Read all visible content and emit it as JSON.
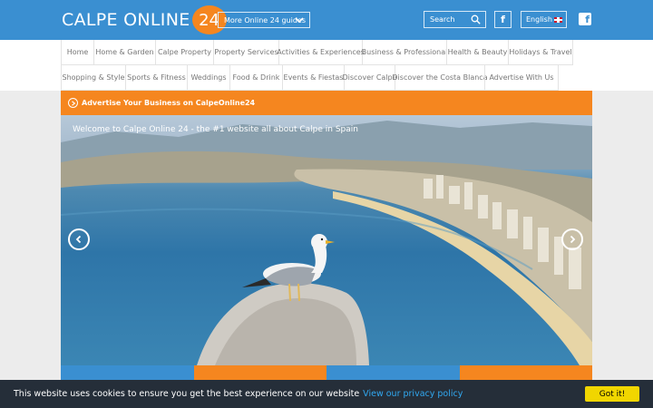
{
  "header": {
    "logo_text": "CALPE ONLINE",
    "logo_number": "24",
    "guides_label": "More Online 24 guides",
    "search_placeholder": "Search",
    "facebook_letter": "f",
    "language_label": "English"
  },
  "nav": {
    "row1": [
      "Home",
      "Home & Garden",
      "Calpe Property",
      "Property Services",
      "Activities & Experiences",
      "Business & Professional",
      "Health & Beauty",
      "Holidays & Travel"
    ],
    "row2": [
      "Shopping & Style",
      "Sports & Fitness",
      "Weddings",
      "Food & Drink",
      "Events & Fiestas",
      "Discover Calpe",
      "Discover the Costa Blanca",
      "Advertise With Us"
    ]
  },
  "advert": {
    "label": "Advertise Your Business on CalpeOnline24"
  },
  "hero": {
    "title": "Welcome to Calpe Online 24 - the #1 website all about Calpe in Spain"
  },
  "cookie": {
    "message": "This website uses cookies to ensure you get the best experience on our website",
    "link": "View our privacy policy",
    "button": "Got it!"
  },
  "colors": {
    "header_blue": "#3a8fd1",
    "accent_orange": "#f5861f",
    "cookie_bg": "#252e39",
    "cookie_link": "#31a8f0",
    "cookie_button": "#f1d600"
  }
}
